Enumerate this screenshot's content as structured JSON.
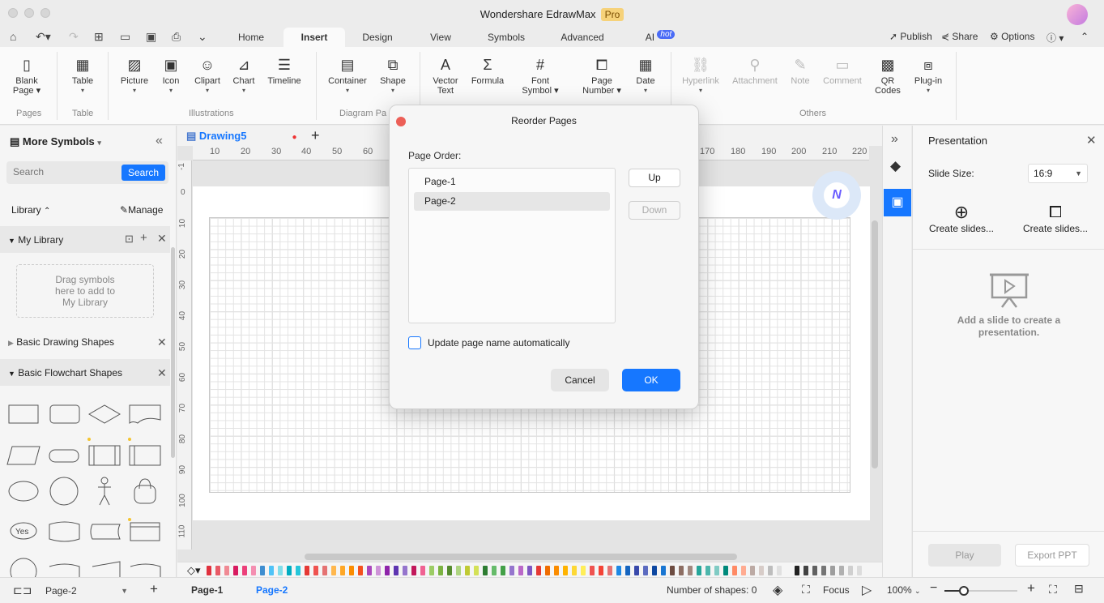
{
  "app": {
    "title": "Wondershare EdrawMax",
    "badge": "Pro"
  },
  "menu": {
    "tabs": [
      "Home",
      "Insert",
      "Design",
      "View",
      "Symbols",
      "Advanced",
      "AI"
    ],
    "ai_badge": "hot",
    "active_tab": "Insert",
    "right": {
      "publish": "Publish",
      "share": "Share",
      "options": "Options"
    }
  },
  "ribbon": {
    "buttons": {
      "blank_page": [
        "Blank",
        "Page"
      ],
      "table": "Table",
      "picture": "Picture",
      "icon": "Icon",
      "clipart": "Clipart",
      "chart": "Chart",
      "timeline": "Timeline",
      "container": "Container",
      "shape": "Shape",
      "vector_text": [
        "Vector",
        "Text"
      ],
      "formula": "Formula",
      "font_symbol": [
        "Font",
        "Symbol"
      ],
      "page_number": [
        "Page",
        "Number"
      ],
      "date": "Date",
      "hyperlink": "Hyperlink",
      "attachment": "Attachment",
      "note": "Note",
      "comment": "Comment",
      "qr_codes": [
        "QR",
        "Codes"
      ],
      "plugin": "Plug-in"
    },
    "groups": {
      "pages": "Pages",
      "table": "Table",
      "illustrations": "Illustrations",
      "diagram_parts": "Diagram Pa",
      "others": "Others"
    }
  },
  "left_panel": {
    "title": "More Symbols",
    "search_placeholder": "Search",
    "search_button": "Search",
    "library_label": "Library",
    "manage_label": "Manage",
    "my_library": "My Library",
    "drag_hint": [
      "Drag symbols",
      "here to add to",
      "My Library"
    ],
    "basic_drawing": "Basic Drawing Shapes",
    "basic_flowchart": "Basic Flowchart Shapes",
    "yes_shape": "Yes"
  },
  "document": {
    "tab_name": "Drawing5",
    "hruler": [
      "10",
      "20",
      "30",
      "40",
      "50",
      "60",
      "170",
      "180",
      "190",
      "200",
      "210",
      "220"
    ],
    "vruler": [
      "-1",
      "0",
      "10",
      "20",
      "30",
      "40",
      "50",
      "60",
      "70",
      "80",
      "90",
      "100",
      "110"
    ]
  },
  "right_panel": {
    "title": "Presentation",
    "slide_size_label": "Slide Size:",
    "slide_size_value": "16:9",
    "create1": "Create slides...",
    "create2": "Create slides...",
    "empty_msg": [
      "Add a slide to create a",
      "presentation."
    ],
    "play": "Play",
    "export": "Export PPT"
  },
  "status": {
    "page_selector": "Page-2",
    "page_tabs": [
      "Page-1",
      "Page-2"
    ],
    "active_page": "Page-2",
    "shapes_count": "Number of shapes: 0",
    "focus": "Focus",
    "zoom": "100%"
  },
  "dialog": {
    "title": "Reorder Pages",
    "page_order_label": "Page Order:",
    "pages": [
      "Page-1",
      "Page-2"
    ],
    "selected": "Page-2",
    "up": "Up",
    "down": "Down",
    "checkbox_label": "Update page name automatically",
    "checkbox_checked": false,
    "cancel": "Cancel",
    "ok": "OK"
  },
  "colors": {
    "accent": "#1677ff",
    "close_red": "#ec5f57",
    "pro_badge": "#f6d27a"
  }
}
